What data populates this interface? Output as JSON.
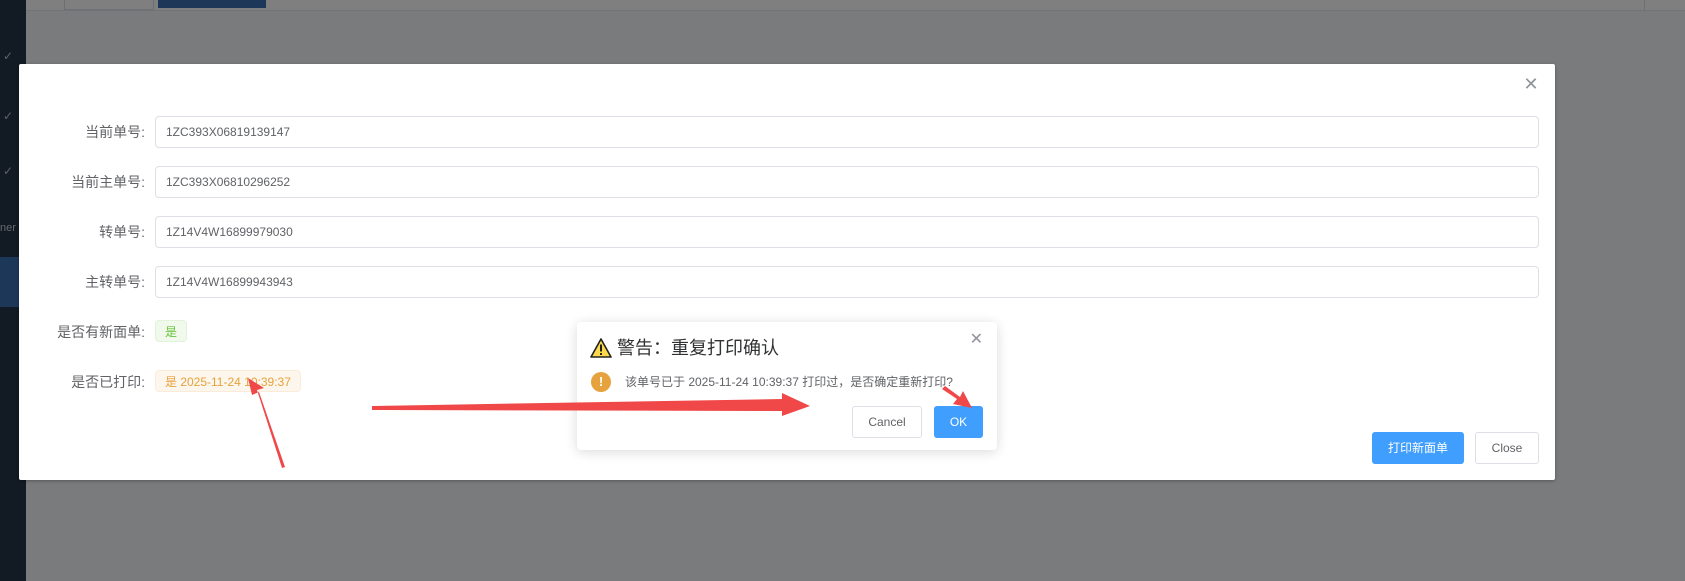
{
  "background": {
    "sidebar_clip_text": "ner"
  },
  "main_dialog": {
    "fields": [
      {
        "label": "当前单号:",
        "value": "1ZC393X06819139147"
      },
      {
        "label": "当前主单号:",
        "value": "1ZC393X06810296252"
      },
      {
        "label": "转单号:",
        "value": "1Z14V4W16899979030"
      },
      {
        "label": "主转单号:",
        "value": "1Z14V4W16899943943"
      }
    ],
    "has_new_label": {
      "label": "是否有新面单:",
      "tag": "是"
    },
    "printed": {
      "label": "是否已打印:",
      "tag": "是 2025-11-24 10:39:37"
    },
    "buttons": {
      "print_new": "打印新面单",
      "close": "Close"
    }
  },
  "message_box": {
    "title": "警告：重复打印确认",
    "message": "该单号已于 2025-11-24 10:39:37 打印过，是否确定重新打印?",
    "cancel_label": "Cancel",
    "ok_label": "OK"
  },
  "colors": {
    "primary": "#409eff",
    "warning": "#e6a23c",
    "success": "#67c23a",
    "annotation_arrow": "#f04848"
  },
  "icons": [
    "warning-triangle-icon",
    "exclamation-circle-icon",
    "close-icon"
  ]
}
